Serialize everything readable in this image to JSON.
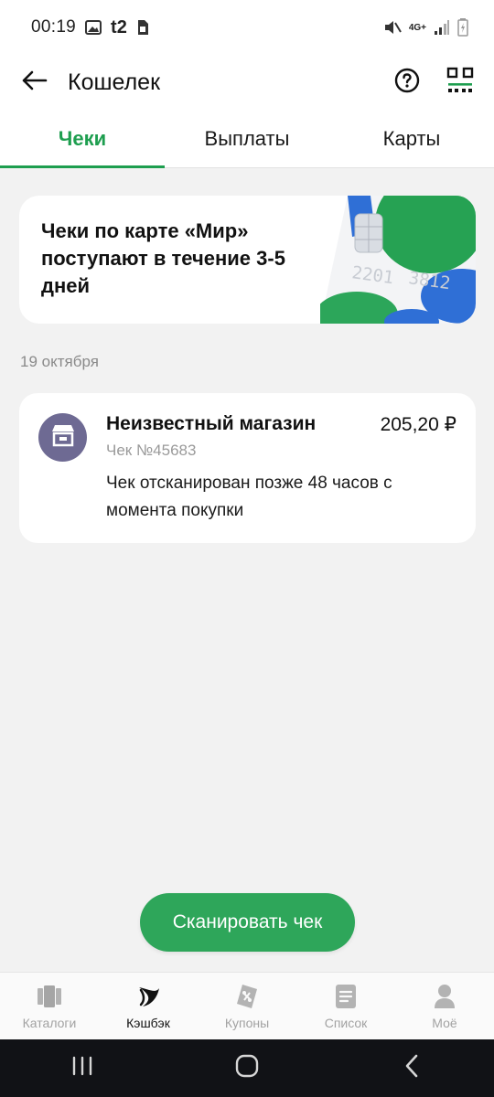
{
  "status_bar": {
    "time": "00:19",
    "carrier": "t2",
    "network": "4G+"
  },
  "app_bar": {
    "title": "Кошелек",
    "back_icon": "arrow-left-icon",
    "help_icon": "help-circle-icon",
    "qr_icon": "qr-scan-icon"
  },
  "tabs": [
    {
      "label": "Чеки",
      "active": true
    },
    {
      "label": "Выплаты",
      "active": false
    },
    {
      "label": "Карты",
      "active": false
    }
  ],
  "banner": {
    "text": "Чеки по карте «Мир» поступают в течение 3-5 дней",
    "card_digits_1": "2201",
    "card_digits_2": "3812"
  },
  "receipts_group": {
    "date": "19 октября",
    "items": [
      {
        "store": "Неизвестный магазин",
        "number": "Чек №45683",
        "amount": "205,20 ₽",
        "note": "Чек отсканирован позже 48 часов с момента покупки",
        "icon": "store-icon"
      }
    ]
  },
  "scan_button": {
    "label": "Сканировать чек"
  },
  "bottom_nav": [
    {
      "label": "Каталоги",
      "icon": "catalogs-icon",
      "active": false
    },
    {
      "label": "Кэшбэк",
      "icon": "cashback-icon",
      "active": true
    },
    {
      "label": "Купоны",
      "icon": "coupons-icon",
      "active": false
    },
    {
      "label": "Список",
      "icon": "list-icon",
      "active": false
    },
    {
      "label": "Моё",
      "icon": "profile-icon",
      "active": false
    }
  ],
  "colors": {
    "accent": "#1e9e4f",
    "button": "#2ea65a",
    "store_avatar": "#6e6a93"
  }
}
